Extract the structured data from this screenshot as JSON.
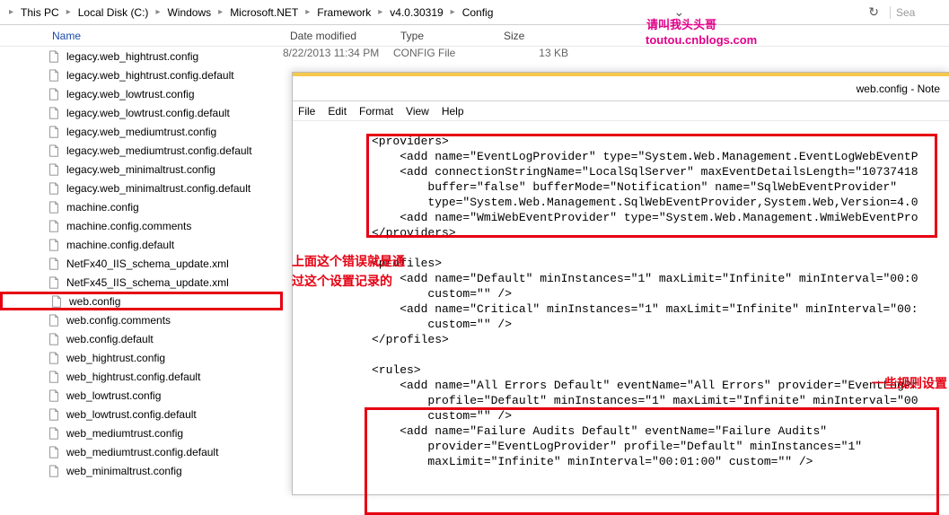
{
  "breadcrumb": {
    "items": [
      "This PC",
      "Local Disk (C:)",
      "Windows",
      "Microsoft.NET",
      "Framework",
      "v4.0.30319",
      "Config"
    ],
    "search_placeholder": "Sea"
  },
  "columns": {
    "name": "Name",
    "date": "Date modified",
    "type": "Type",
    "size": "Size"
  },
  "watermark": {
    "line1": "请叫我头头哥",
    "line2": "toutou.cnblogs.com"
  },
  "files": [
    {
      "name": "legacy.web_hightrust.config",
      "date": "8/22/2013 11:34 PM",
      "type": "CONFIG File",
      "size": "13 KB"
    },
    {
      "name": "legacy.web_hightrust.config.default"
    },
    {
      "name": "legacy.web_lowtrust.config"
    },
    {
      "name": "legacy.web_lowtrust.config.default"
    },
    {
      "name": "legacy.web_mediumtrust.config"
    },
    {
      "name": "legacy.web_mediumtrust.config.default"
    },
    {
      "name": "legacy.web_minimaltrust.config"
    },
    {
      "name": "legacy.web_minimaltrust.config.default"
    },
    {
      "name": "machine.config"
    },
    {
      "name": "machine.config.comments"
    },
    {
      "name": "machine.config.default"
    },
    {
      "name": "NetFx40_IIS_schema_update.xml"
    },
    {
      "name": "NetFx45_IIS_schema_update.xml"
    },
    {
      "name": "web.config",
      "selected": true
    },
    {
      "name": "web.config.comments"
    },
    {
      "name": "web.config.default"
    },
    {
      "name": "web_hightrust.config"
    },
    {
      "name": "web_hightrust.config.default"
    },
    {
      "name": "web_lowtrust.config"
    },
    {
      "name": "web_lowtrust.config.default"
    },
    {
      "name": "web_mediumtrust.config"
    },
    {
      "name": "web_mediumtrust.config.default"
    },
    {
      "name": "web_minimaltrust.config"
    }
  ],
  "notepad": {
    "title": "web.config - Note",
    "menu": [
      "File",
      "Edit",
      "Format",
      "View",
      "Help"
    ],
    "content": "<providers>\n    <add name=\"EventLogProvider\" type=\"System.Web.Management.EventLogWebEventP\n    <add connectionStringName=\"LocalSqlServer\" maxEventDetailsLength=\"10737418\n        buffer=\"false\" bufferMode=\"Notification\" name=\"SqlWebEventProvider\"\n        type=\"System.Web.Management.SqlWebEventProvider,System.Web,Version=4.0\n    <add name=\"WmiWebEventProvider\" type=\"System.Web.Management.WmiWebEventPro\n</providers>\n\n<profiles>\n    <add name=\"Default\" minInstances=\"1\" maxLimit=\"Infinite\" minInterval=\"00:0\n        custom=\"\" />\n    <add name=\"Critical\" minInstances=\"1\" maxLimit=\"Infinite\" minInterval=\"00:\n        custom=\"\" />\n</profiles>\n\n<rules>\n    <add name=\"All Errors Default\" eventName=\"All Errors\" provider=\"EventLogPr\n        profile=\"Default\" minInstances=\"1\" maxLimit=\"Infinite\" minInterval=\"00\n        custom=\"\" />\n    <add name=\"Failure Audits Default\" eventName=\"Failure Audits\"\n        provider=\"EventLogProvider\" profile=\"Default\" minInstances=\"1\"\n        maxLimit=\"Infinite\" minInterval=\"00:01:00\" custom=\"\" />"
  },
  "annotations": {
    "a1_line1": "上面这个错误就是通",
    "a1_line2": "过这个设置记录的",
    "a2": "一些规则设置"
  }
}
